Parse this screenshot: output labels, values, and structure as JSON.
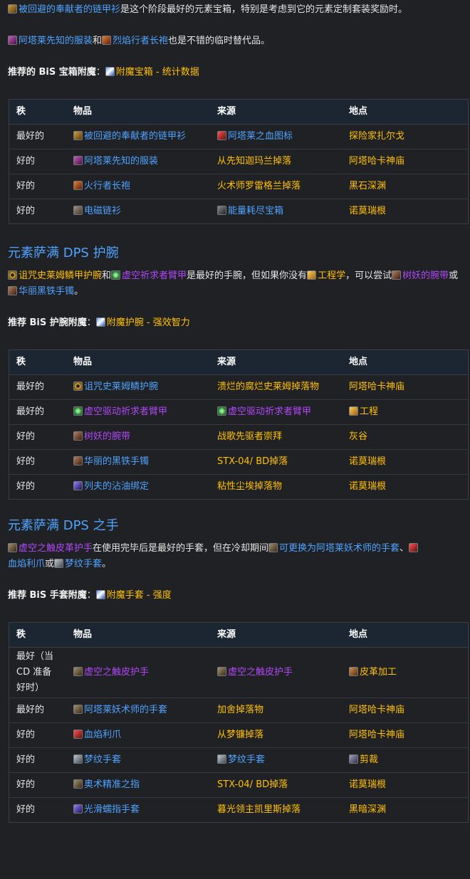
{
  "chest_intro": {
    "item_a": "被回避的奉献者的链甲衫",
    "text_a": "是这个阶段最好的元素宝箱，特别是考虑到它的元素定制套装奖励时。",
    "item_b": "阿塔莱先知的服装",
    "and": "和",
    "item_c": "烈焰行者长袍",
    "text_b": "也是不错的临时替代品。",
    "bis_label": "推荐的 BiS 宝箱附魔",
    "colon": "：",
    "bis_link": "附魔宝箱 - 统计数据"
  },
  "headers": [
    "秩",
    "物品",
    "来源",
    "地点"
  ],
  "chest_table": [
    {
      "rank": "最好的",
      "item": "被回避的奉献者的链甲衫",
      "item_icon": "armor",
      "source": "阿塔莱之血图标",
      "source_icon": "red",
      "source_color": "blue",
      "location": "探险家扎尔戈"
    },
    {
      "rank": "好的",
      "item": "阿塔莱先知的服装",
      "item_icon": "robe",
      "source": "从先知迦玛兰掉落",
      "source_icon": "",
      "source_color": "gold",
      "location": "阿塔哈卡神庙"
    },
    {
      "rank": "好的",
      "item": "火行者长袍",
      "item_icon": "fire",
      "source": "火术师罗雷格兰掉落",
      "source_icon": "",
      "source_color": "gold",
      "location": "黑石深渊"
    },
    {
      "rank": "好的",
      "item": "电磁链衫",
      "item_icon": "chain",
      "source": "能量耗尽宝箱",
      "source_icon": "box",
      "source_color": "blue",
      "location": "诺莫瑞根"
    }
  ],
  "wrist": {
    "heading": "元素萨满 DPS 护腕",
    "item_a": "诅咒史莱姆鳞甲护腕",
    "and": "和",
    "item_b": "虚空祈求者臂甲",
    "text_a": "是最好的手腕，但如果你没有",
    "eng": "工程学",
    "text_b": "，可以尝试",
    "item_c": "树妖的腕带",
    "or": "或",
    "item_d": "华丽黑铁手镯",
    "period": "。",
    "bis_label": "推荐 BiS 护腕附魔",
    "colon": "：",
    "bis_link": "附魔护腕 - 强效智力"
  },
  "wrist_table": [
    {
      "rank": "最好的",
      "item": "诅咒史莱姆鳞护腕",
      "item_icon": "ring",
      "item_color": "blue",
      "source": "溃烂的腐烂史莱姆掉落物",
      "source_icon": "",
      "location": "阿塔哈卡神庙",
      "loc_icon": ""
    },
    {
      "rank": "最好的",
      "item": "虚空驱动祈求者臂甲",
      "item_icon": "green",
      "item_color": "purple",
      "source": "虚空驱动祈求者臂甲",
      "source_icon": "green",
      "location": "工程",
      "loc_icon": "gear"
    },
    {
      "rank": "好的",
      "item": "树妖的腕带",
      "item_icon": "brown",
      "item_color": "purple",
      "source": "战歌先驱者崇拜",
      "source_icon": "",
      "location": "灰谷",
      "loc_icon": ""
    },
    {
      "rank": "好的",
      "item": "华丽的黑铁手镯",
      "item_icon": "brown",
      "item_color": "blue",
      "source": "STX-04/ BD掉落",
      "source_icon": "",
      "location": "诺莫瑞根",
      "loc_icon": ""
    },
    {
      "rank": "好的",
      "item": "列夫的沾油绑定",
      "item_icon": "violet",
      "item_color": "blue",
      "source": "粘性尘埃掉落物",
      "source_icon": "",
      "location": "诺莫瑞根",
      "loc_icon": ""
    }
  ],
  "hands": {
    "heading": "元素萨满 DPS 之手",
    "item_a": "虚空之触皮革护手",
    "text_a": "在使用完毕后是最好的手套，但在冷却期间",
    "text_b": "可更换为阿塔莱妖术师的手套",
    "comma": "、",
    "item_c": "血焰利爪",
    "or": "或",
    "item_d": "梦纹手套",
    "period": "。",
    "bis_label": "推荐 BiS 手套附魔",
    "colon": "：",
    "bis_link": "附魔手套 - 强度"
  },
  "hands_table": [
    {
      "rank": "最好（当CD 准备好时）",
      "item": "虚空之触皮护手",
      "item_icon": "glove",
      "item_color": "purple",
      "source": "虚空之触皮护手",
      "source_icon": "glove",
      "location": "皮革加工",
      "loc_icon": "leather"
    },
    {
      "rank": "最好的",
      "item": "阿塔莱妖术师的手套",
      "item_icon": "glove",
      "item_color": "blue",
      "source": "加舍掉落物",
      "source_icon": "",
      "location": "阿塔哈卡神庙",
      "loc_icon": ""
    },
    {
      "rank": "好的",
      "item": "血焰利爪",
      "item_icon": "red",
      "item_color": "blue",
      "source": "从梦镰掉落",
      "source_icon": "",
      "location": "阿塔哈卡神庙",
      "loc_icon": ""
    },
    {
      "rank": "好的",
      "item": "梦纹手套",
      "item_icon": "silver",
      "item_color": "blue",
      "source": "梦纹手套",
      "source_icon": "silver",
      "location": "剪裁",
      "loc_icon": "scissor"
    },
    {
      "rank": "好的",
      "item": "奥术精准之指",
      "item_icon": "glove",
      "item_color": "blue",
      "source": "STX-04/ BD掉落",
      "source_icon": "",
      "location": "诺莫瑞根",
      "loc_icon": ""
    },
    {
      "rank": "好的",
      "item": "光滑蠕指手套",
      "item_icon": "violet",
      "item_color": "blue",
      "source": "暮光领主凯里斯掉落",
      "source_icon": "",
      "location": "黑暗深渊",
      "loc_icon": ""
    }
  ]
}
